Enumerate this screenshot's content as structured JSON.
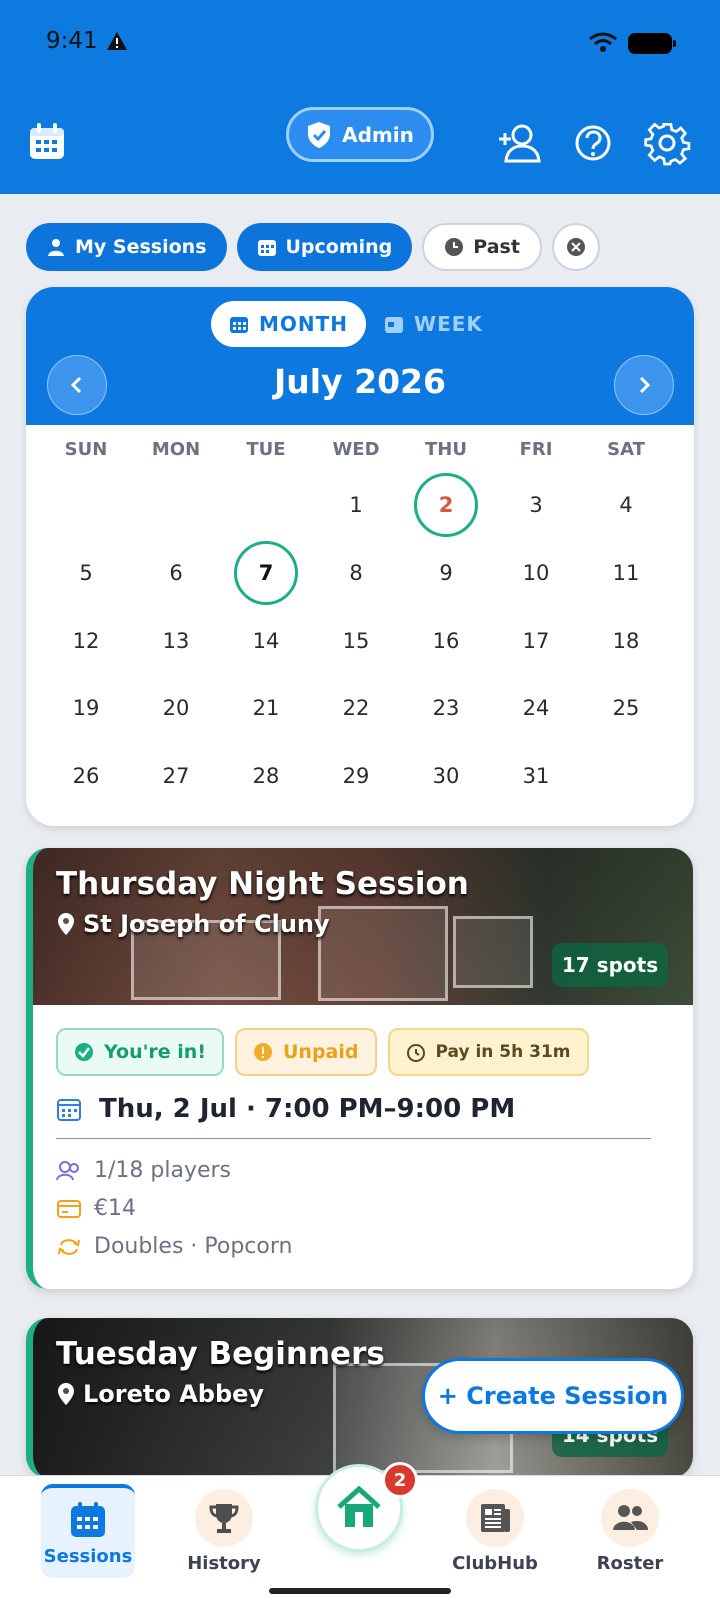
{
  "statusbar": {
    "time": "9:41",
    "icons": [
      "warning-icon",
      "wifi-icon",
      "battery-icon"
    ]
  },
  "appbar": {
    "admin_label": "Admin",
    "icons": [
      "calendar-icon",
      "add-user-icon",
      "help-icon",
      "settings-icon"
    ]
  },
  "filters": [
    {
      "label": "My Sessions",
      "icon": "person-icon",
      "active": true
    },
    {
      "label": "Upcoming",
      "icon": "calendar-icon",
      "active": true
    },
    {
      "label": "Past",
      "icon": "clock-icon",
      "active": false
    }
  ],
  "calendar": {
    "view_tabs": [
      "MONTH",
      "WEEK"
    ],
    "selected_view": "MONTH",
    "month_title": "July 2026",
    "weekdays": [
      "SUN",
      "MON",
      "TUE",
      "WED",
      "THU",
      "FRI",
      "SAT"
    ],
    "weeks": [
      [
        "",
        "",
        "",
        "1",
        "2",
        "3",
        "4"
      ],
      [
        "5",
        "6",
        "7",
        "8",
        "9",
        "10",
        "11"
      ],
      [
        "12",
        "13",
        "14",
        "15",
        "16",
        "17",
        "18"
      ],
      [
        "19",
        "20",
        "21",
        "22",
        "23",
        "24",
        "25"
      ],
      [
        "26",
        "27",
        "28",
        "29",
        "30",
        "31",
        ""
      ]
    ],
    "session_days": [
      "2",
      "7"
    ],
    "today": "7"
  },
  "sessions": [
    {
      "title": "Thursday Night Session",
      "location": "St Joseph of Cluny",
      "spots": "17 spots",
      "badges": [
        "You're in!",
        "Unpaid",
        "Pay in 5h 31m"
      ],
      "datetime": "Thu, 2 Jul · 7:00 PM–9:00 PM",
      "players": "1/18 players",
      "price": "€14",
      "format": "Doubles · Popcorn"
    },
    {
      "title": "Tuesday Beginners",
      "location": "Loreto Abbey",
      "spots": "14 spots"
    }
  ],
  "fab": {
    "label": "+ Create Session"
  },
  "bottom_nav": [
    {
      "label": "Sessions",
      "active": true
    },
    {
      "label": "History",
      "active": false
    },
    {
      "label": "",
      "badge": "2",
      "active": false
    },
    {
      "label": "ClubHub",
      "active": false
    },
    {
      "label": "Roster",
      "active": false
    }
  ],
  "colors": {
    "primary": "#0d78e0",
    "green": "#1cae86",
    "warning": "#e8a21b",
    "error": "#d83a2e"
  }
}
